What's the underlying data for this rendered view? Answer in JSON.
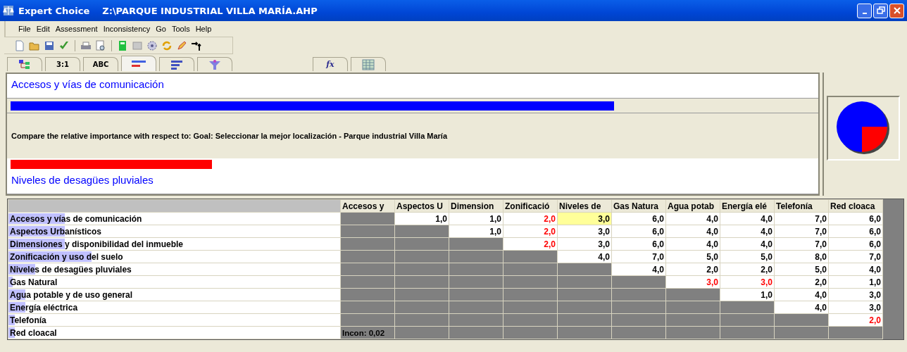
{
  "window": {
    "app": "Expert Choice",
    "title": "Z:\\PARQUE INDUSTRIAL VILLA MARÍA.AHP"
  },
  "menu": [
    "File",
    "Edit",
    "Assessment",
    "Inconsistency",
    "Go",
    "Tools",
    "Help"
  ],
  "tabs": [
    {
      "kind": "tree",
      "selected": false
    },
    {
      "kind": "text",
      "label": "3:1",
      "selected": false
    },
    {
      "kind": "text",
      "label": "ABC",
      "selected": false
    },
    {
      "kind": "bars",
      "selected": true
    },
    {
      "kind": "hbars",
      "selected": false
    },
    {
      "kind": "funnel",
      "selected": false
    },
    {
      "kind": "formula",
      "label": "fx",
      "selected": false
    },
    {
      "kind": "grid",
      "selected": false
    }
  ],
  "comparison": {
    "left": {
      "name": "Accesos y vías de comunicación",
      "level": 0.75
    },
    "prompt": "Compare the relative importance with respect to: Goal: Seleccionar la mejor localización - Parque industrial Villa María",
    "right": {
      "name": "Niveles de desagües pluviales",
      "level": 0.25
    }
  },
  "table": {
    "columns": [
      "Accesos y",
      "Aspectos U",
      "Dimension",
      "Zonificació",
      "Niveles de",
      "Gas Natura",
      "Agua potab",
      "Energía elé",
      "Telefonía",
      "Red cloaca"
    ],
    "rows": [
      {
        "name": "Accesos y vías de comunicación",
        "level": 0.17,
        "values": [
          {
            "text": "1,0",
            "inverted": false,
            "selected": false
          },
          {
            "text": "1,0",
            "inverted": false,
            "selected": false
          },
          {
            "text": "2,0",
            "inverted": true,
            "selected": false
          },
          {
            "text": "3,0",
            "inverted": false,
            "selected": true
          },
          {
            "text": "6,0",
            "inverted": false,
            "selected": false
          },
          {
            "text": "4,0",
            "inverted": false,
            "selected": false
          },
          {
            "text": "4,0",
            "inverted": false,
            "selected": false
          },
          {
            "text": "7,0",
            "inverted": false,
            "selected": false
          },
          {
            "text": "6,0",
            "inverted": false,
            "selected": false
          }
        ]
      },
      {
        "name": "Aspectos Urbanísticos",
        "level": 0.17,
        "values": [
          {
            "text": "1,0",
            "inverted": false,
            "selected": false
          },
          {
            "text": "2,0",
            "inverted": true,
            "selected": false
          },
          {
            "text": "3,0",
            "inverted": false,
            "selected": false
          },
          {
            "text": "6,0",
            "inverted": false,
            "selected": false
          },
          {
            "text": "4,0",
            "inverted": false,
            "selected": false
          },
          {
            "text": "4,0",
            "inverted": false,
            "selected": false
          },
          {
            "text": "7,0",
            "inverted": false,
            "selected": false
          },
          {
            "text": "6,0",
            "inverted": false,
            "selected": false
          }
        ]
      },
      {
        "name": "Dimensiones y disponibilidad del inmueble",
        "level": 0.17,
        "values": [
          {
            "text": "2,0",
            "inverted": true,
            "selected": false
          },
          {
            "text": "3,0",
            "inverted": false,
            "selected": false
          },
          {
            "text": "6,0",
            "inverted": false,
            "selected": false
          },
          {
            "text": "4,0",
            "inverted": false,
            "selected": false
          },
          {
            "text": "4,0",
            "inverted": false,
            "selected": false
          },
          {
            "text": "7,0",
            "inverted": false,
            "selected": false
          },
          {
            "text": "6,0",
            "inverted": false,
            "selected": false
          }
        ]
      },
      {
        "name": "Zonificación y uso del suelo",
        "level": 0.25,
        "values": [
          {
            "text": "4,0",
            "inverted": false,
            "selected": false
          },
          {
            "text": "7,0",
            "inverted": false,
            "selected": false
          },
          {
            "text": "5,0",
            "inverted": false,
            "selected": false
          },
          {
            "text": "5,0",
            "inverted": false,
            "selected": false
          },
          {
            "text": "8,0",
            "inverted": false,
            "selected": false
          },
          {
            "text": "7,0",
            "inverted": false,
            "selected": false
          }
        ]
      },
      {
        "name": "Niveles de desagües pluviales",
        "level": 0.08,
        "values": [
          {
            "text": "4,0",
            "inverted": false,
            "selected": false
          },
          {
            "text": "2,0",
            "inverted": false,
            "selected": false
          },
          {
            "text": "2,0",
            "inverted": false,
            "selected": false
          },
          {
            "text": "5,0",
            "inverted": false,
            "selected": false
          },
          {
            "text": "4,0",
            "inverted": false,
            "selected": false
          }
        ]
      },
      {
        "name": "Gas Natural",
        "level": 0.013,
        "values": [
          {
            "text": "3,0",
            "inverted": true,
            "selected": false
          },
          {
            "text": "3,0",
            "inverted": true,
            "selected": false
          },
          {
            "text": "2,0",
            "inverted": false,
            "selected": false
          },
          {
            "text": "1,0",
            "inverted": false,
            "selected": false
          }
        ]
      },
      {
        "name": "Agua potable y de uso general",
        "level": 0.05,
        "values": [
          {
            "text": "1,0",
            "inverted": false,
            "selected": false
          },
          {
            "text": "4,0",
            "inverted": false,
            "selected": false
          },
          {
            "text": "3,0",
            "inverted": false,
            "selected": false
          }
        ]
      },
      {
        "name": "Energía eléctrica",
        "level": 0.05,
        "values": [
          {
            "text": "4,0",
            "inverted": false,
            "selected": false
          },
          {
            "text": "3,0",
            "inverted": false,
            "selected": false
          }
        ]
      },
      {
        "name": "Telefonía",
        "level": 0.02,
        "values": [
          {
            "text": "2,0",
            "inverted": true,
            "selected": false
          }
        ]
      },
      {
        "name": "Red cloacal",
        "level": 0.02,
        "values": []
      }
    ],
    "inconsistency": "Incon: 0,02"
  }
}
